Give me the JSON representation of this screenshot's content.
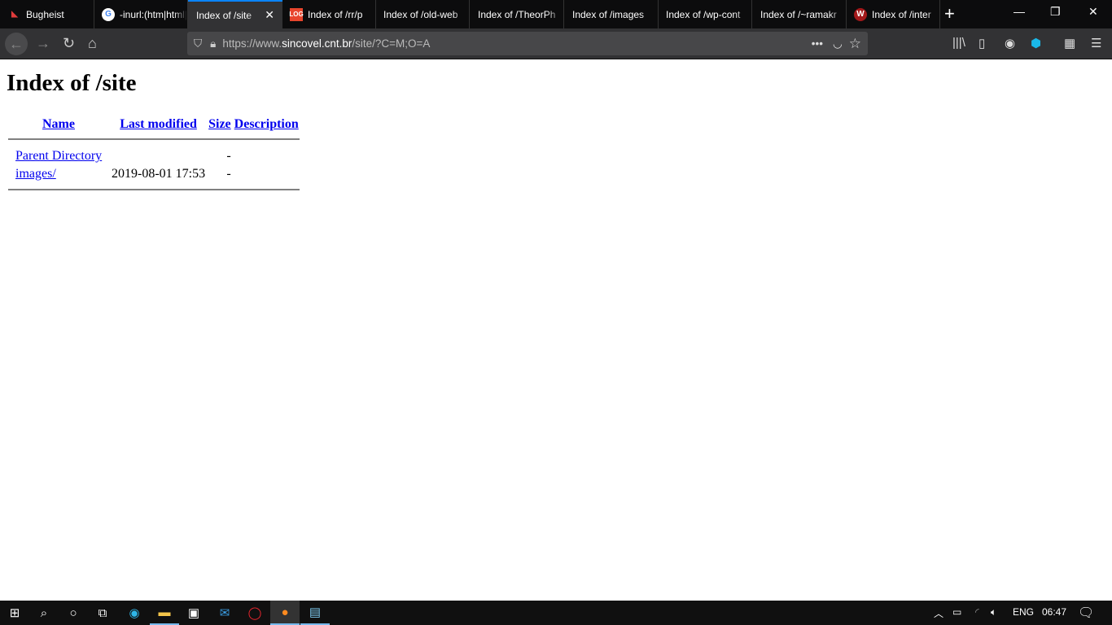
{
  "browser": {
    "tabs": [
      {
        "title": "Bugheist",
        "icon": "bugheist-icon",
        "color": "#e03b3b"
      },
      {
        "title": "-inurl:(htm|html|php|pls|txt)",
        "icon": "google-icon",
        "color": "#4285f4"
      },
      {
        "title": "Index of /site",
        "active": true
      },
      {
        "title": "Index of /rr/p",
        "icon": "log-icon",
        "color": "#e8452c"
      },
      {
        "title": "Index of /old-web"
      },
      {
        "title": "Index of /TheorPh"
      },
      {
        "title": "Index of /images"
      },
      {
        "title": "Index of /wp-cont"
      },
      {
        "title": "Index of /~ramakr"
      },
      {
        "title": "Index of /inter",
        "icon": "w-icon",
        "color": "#a3191b"
      }
    ],
    "url_prefix": "https://www.",
    "url_domain": "sincovel.cnt.br",
    "url_path": "/site/?C=M;O=A"
  },
  "page": {
    "title": "Index of /site",
    "headers": {
      "name": "Name",
      "modified": "Last modified",
      "size": "Size",
      "description": "Description"
    },
    "rows": [
      {
        "name": "Parent Directory",
        "modified": "",
        "size": "-",
        "description": ""
      },
      {
        "name": "images/",
        "modified": "2019-08-01 17:53",
        "size": "-",
        "description": ""
      }
    ]
  },
  "taskbar": {
    "language": "ENG",
    "time": "06:47"
  }
}
